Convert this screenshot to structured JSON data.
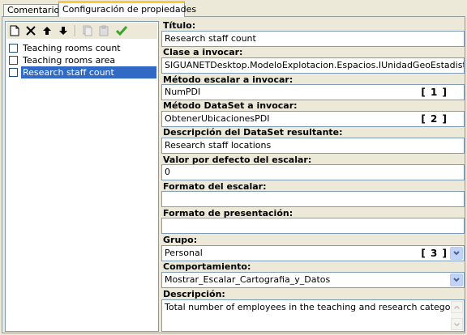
{
  "tabs": [
    {
      "label": "Comentarios"
    },
    {
      "label": "Configuración de propiedades"
    }
  ],
  "list": {
    "items": [
      {
        "label": "Teaching rooms count",
        "checked": false,
        "selected": false
      },
      {
        "label": "Teaching rooms area",
        "checked": false,
        "selected": false
      },
      {
        "label": "Research staff count",
        "checked": false,
        "selected": true
      }
    ]
  },
  "form": {
    "titulo_label": "Título:",
    "titulo_value": "Research staff count",
    "clase_label": "Clase a invocar:",
    "clase_value": "SIGUANETDesktop.ModeloExplotacion.Espacios.IUnidadGeoEstadistica",
    "metodo_escalar_label": "Método escalar a invocar:",
    "metodo_escalar_value": "NumPDI",
    "metodo_escalar_marker": "[ 1 ]",
    "metodo_dataset_label": "Método DataSet a invocar:",
    "metodo_dataset_value": "ObtenerUbicacionesPDI",
    "metodo_dataset_marker": "[ 2 ]",
    "descripcion_dataset_label": "Descripción del DataSet resultante:",
    "descripcion_dataset_value": "Research staff locations",
    "valor_defecto_label": "Valor por defecto del escalar:",
    "valor_defecto_value": "0",
    "formato_escalar_label": "Formato del escalar:",
    "formato_escalar_value": "",
    "formato_presentacion_label": "Formato de presentación:",
    "formato_presentacion_value": "",
    "grupo_label": "Grupo:",
    "grupo_value": "Personal",
    "grupo_marker": "[ 3 ]",
    "comportamiento_label": "Comportamiento:",
    "comportamiento_value": "Mostrar_Escalar_Cartografia_y_Datos",
    "descripcion_label": "Descripción:",
    "descripcion_value": "Total number of employees in the teaching and research category"
  },
  "colors": {
    "selection": "#316ac5",
    "dropdown_button": "#c1d3fb",
    "accept_icon": "#3aa52a"
  },
  "toolbar_icons": [
    "new-icon",
    "delete-icon",
    "move-up-icon",
    "move-down-icon",
    "copy-icon",
    "paste-icon",
    "accept-icon"
  ]
}
